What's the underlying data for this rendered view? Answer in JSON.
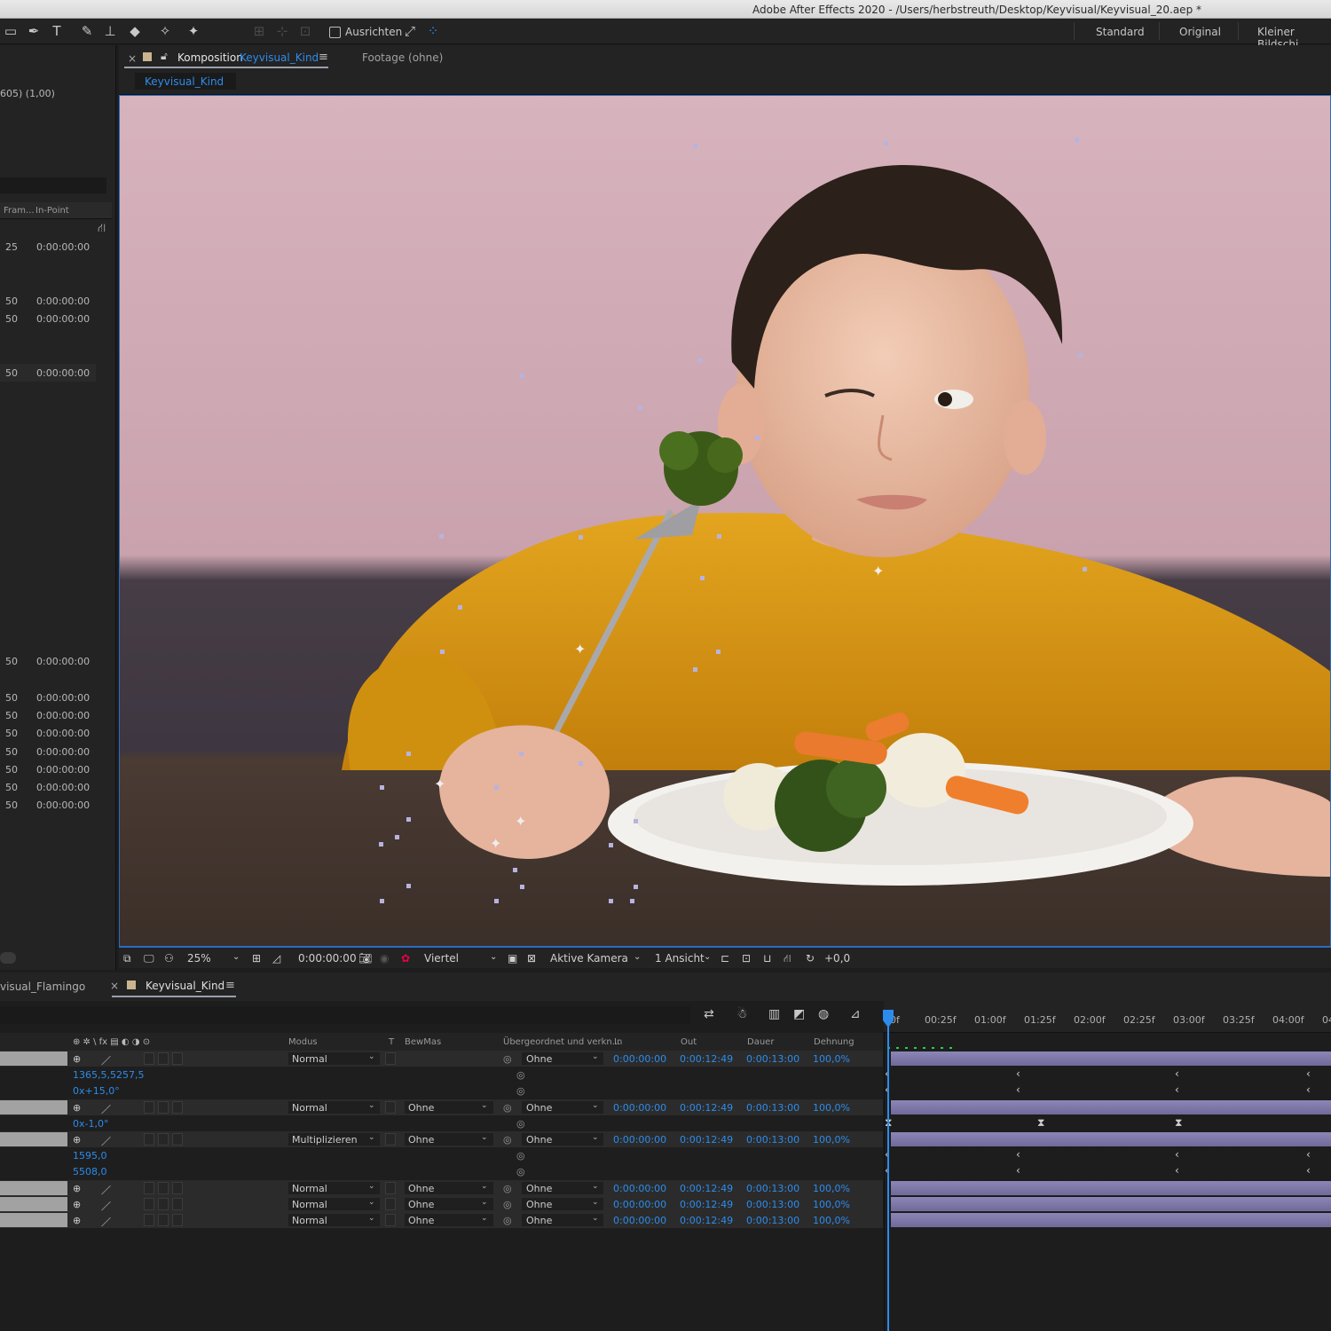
{
  "window": {
    "title": "Adobe After Effects 2020 - /Users/herbstreuth/Desktop/Keyvisual/Keyvisual_20.aep *"
  },
  "toolbar": {
    "align_label": "Ausrichten",
    "workspaces": [
      "Standard",
      "Original",
      "Kleiner Bildschi"
    ]
  },
  "left_panel": {
    "header_fragment": "605) (1,00)",
    "columns": [
      "Fram...",
      "In-Point"
    ],
    "rows": [
      {
        "frames": "25",
        "in_point": "0:00:00:00"
      },
      {
        "frames": "50",
        "in_point": "0:00:00:00"
      },
      {
        "frames": "50",
        "in_point": "0:00:00:00"
      },
      {
        "frames": "50",
        "in_point": "0:00:00:00"
      },
      {
        "frames": "50",
        "in_point": "0:00:00:00"
      },
      {
        "frames": "50",
        "in_point": "0:00:00:00"
      },
      {
        "frames": "50",
        "in_point": "0:00:00:00"
      },
      {
        "frames": "50",
        "in_point": "0:00:00:00"
      },
      {
        "frames": "50",
        "in_point": "0:00:00:00"
      },
      {
        "frames": "50",
        "in_point": "0:00:00:00"
      },
      {
        "frames": "50",
        "in_point": "0:00:00:00"
      },
      {
        "frames": "50",
        "in_point": "0:00:00:00"
      }
    ]
  },
  "comp_panel": {
    "close": "×",
    "tab_prefix": "Komposition",
    "tab_name": "Keyvisual_Kind",
    "menu": "≡",
    "footage_tab": "Footage (ohne)",
    "breadcrumb": "Keyvisual_Kind"
  },
  "viewer_bar": {
    "zoom": "25%",
    "timecode": "0:00:00:00",
    "resolution": "Viertel",
    "camera": "Aktive Kamera",
    "views": "1 Ansicht",
    "exposure": "+0,0"
  },
  "timeline": {
    "tab_prev": "visual_Flamingo",
    "tab_active": "Keyvisual_Kind",
    "columns": {
      "icons": "⊕ ✲ \\ fx ▤ ◐ ◑ ⊙",
      "modus": "Modus",
      "t": "T",
      "bewmas": "BewMas",
      "parent": "Übergeordnet und verkn...",
      "in": "In",
      "out": "Out",
      "dauer": "Dauer",
      "dehnung": "Dehnung"
    },
    "ruler": [
      "0f",
      "00:25f",
      "01:00f",
      "01:25f",
      "02:00f",
      "02:25f",
      "03:00f",
      "03:25f",
      "04:00f",
      "04"
    ],
    "rows": [
      {
        "type": "layer",
        "mode": "Normal",
        "trkmat": "",
        "parent": "Ohne",
        "in": "0:00:00:00",
        "out": "0:00:12:49",
        "dur": "0:00:13:00",
        "stretch": "100,0%"
      },
      {
        "type": "prop",
        "value": "1365,5,5257,5"
      },
      {
        "type": "prop",
        "value": "0x+15,0°"
      },
      {
        "type": "layer",
        "mode": "Normal",
        "trkmat": "Ohne",
        "parent": "Ohne",
        "in": "0:00:00:00",
        "out": "0:00:12:49",
        "dur": "0:00:13:00",
        "stretch": "100,0%"
      },
      {
        "type": "prop",
        "value": "0x-1,0°"
      },
      {
        "type": "layer",
        "mode": "Multiplizieren",
        "trkmat": "Ohne",
        "parent": "Ohne",
        "in": "0:00:00:00",
        "out": "0:00:12:49",
        "dur": "0:00:13:00",
        "stretch": "100,0%"
      },
      {
        "type": "prop",
        "value": "1595,0"
      },
      {
        "type": "prop",
        "value": "5508,0"
      },
      {
        "type": "layer",
        "mode": "Normal",
        "trkmat": "Ohne",
        "parent": "Ohne",
        "in": "0:00:00:00",
        "out": "0:00:12:49",
        "dur": "0:00:13:00",
        "stretch": "100,0%"
      },
      {
        "type": "layer",
        "mode": "Normal",
        "trkmat": "Ohne",
        "parent": "Ohne",
        "in": "0:00:00:00",
        "out": "0:00:12:49",
        "dur": "0:00:13:00",
        "stretch": "100,0%"
      },
      {
        "type": "layer",
        "mode": "Normal",
        "trkmat": "Ohne",
        "parent": "Ohne",
        "in": "0:00:00:00",
        "out": "0:00:12:49",
        "dur": "0:00:13:00",
        "stretch": "100,0%"
      }
    ]
  },
  "colors": {
    "accent": "#2d8ceb",
    "layer_bar": "#8c86b7",
    "panel": "#232323"
  }
}
